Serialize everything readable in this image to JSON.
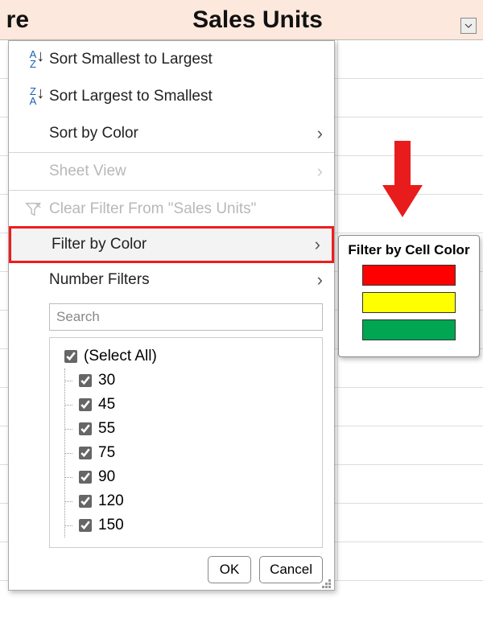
{
  "header": {
    "left_fragment": "re",
    "column_title": "Sales Units"
  },
  "menu": {
    "sort_asc": "Sort Smallest to Largest",
    "sort_desc": "Sort Largest to Smallest",
    "sort_by_color": "Sort by Color",
    "sheet_view": "Sheet View",
    "clear_filter": "Clear Filter From \"Sales Units\"",
    "filter_by_color": "Filter by Color",
    "number_filters": "Number Filters"
  },
  "search": {
    "placeholder": "Search"
  },
  "tree": {
    "select_all": "(Select All)",
    "items": [
      "30",
      "45",
      "55",
      "75",
      "90",
      "120",
      "150"
    ]
  },
  "buttons": {
    "ok": "OK",
    "cancel": "Cancel"
  },
  "flyout": {
    "title": "Filter by Cell Color",
    "colors": [
      "#ff0000",
      "#ffff00",
      "#00a651"
    ]
  }
}
